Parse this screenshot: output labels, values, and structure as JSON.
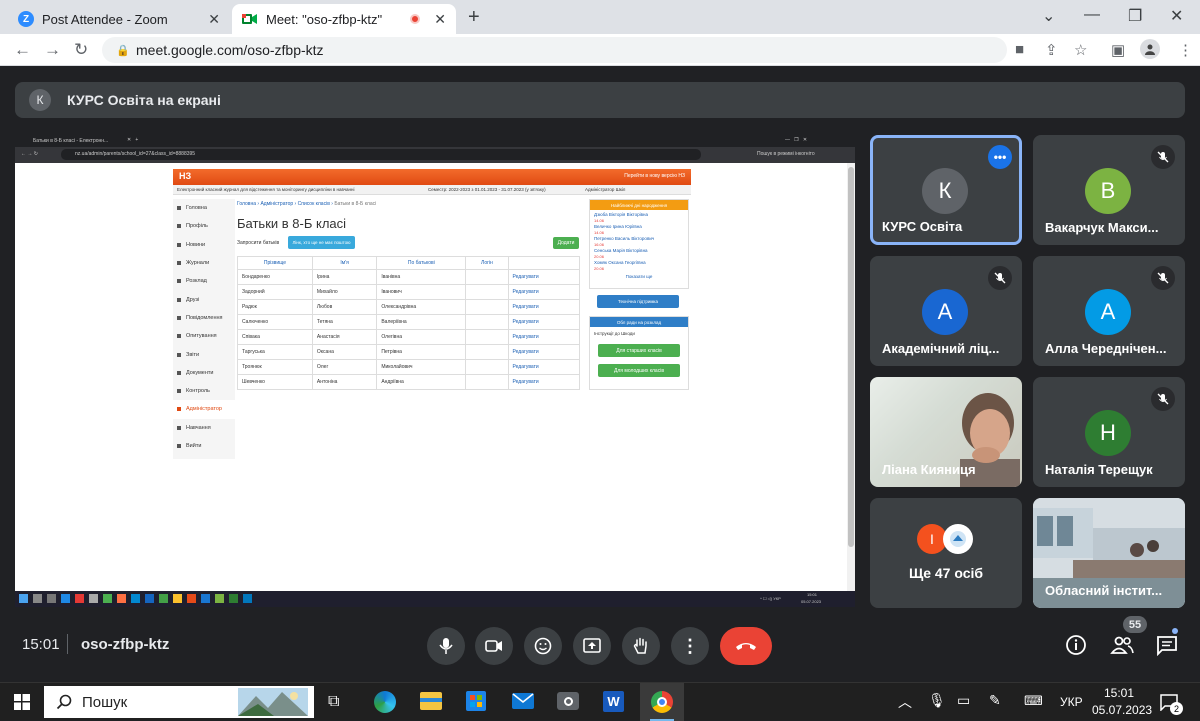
{
  "browser": {
    "tabs": [
      {
        "title": "Post Attendee - Zoom",
        "favicon": "zoom-icon"
      },
      {
        "title": "Meet: \"oso-zfbp-ktz\"",
        "favicon": "meet-icon"
      }
    ],
    "url": "meet.google.com/oso-zfbp-ktz"
  },
  "meet": {
    "banner": {
      "initial": "К",
      "text": "КУРС Освіта на екрані"
    },
    "participants": [
      {
        "name": "КУРС Освіта",
        "initial": "К",
        "color": "#5f6368",
        "active": true
      },
      {
        "name": "Вакарчук Макси...",
        "initial": "В",
        "color": "#7cb342",
        "muted": true
      },
      {
        "name": "Академічний ліц...",
        "initial": "А",
        "color": "#1967d2",
        "muted": true
      },
      {
        "name": "Алла Череднічен...",
        "initial": "А",
        "color": "#039be5",
        "muted": true
      },
      {
        "name": "Ліана Кияниця",
        "video": true
      },
      {
        "name": "Наталія Терещук",
        "initial": "Н",
        "color": "#2e7d32",
        "muted": true
      },
      {
        "name": "Ще 47 осіб",
        "initial": "І",
        "color": "#f4511e"
      },
      {
        "name": "Обласний інстит...",
        "video": true
      }
    ],
    "time": "15:01",
    "meeting_code": "oso-zfbp-ktz",
    "participant_count": "55"
  },
  "shared": {
    "inner_tab": "Батьки в 8-Б класі - Електронн...",
    "inner_url": "nz.ua/admin/parents/school_id=27&class_id=8888395",
    "site_logo": "НЗ",
    "top_link": "Перейти в нову версію НЗ",
    "subheader_text": "Електронний класний журнал для відстеження та моніторингу дисципліни в навчанні",
    "period_label": "Семестр: 2022-2023 з 01.01.2023 - 31.07.2023 (у зв'язку)",
    "user_label": "Адміністратор Шкіл",
    "nav": [
      "Головна",
      "Профіль",
      "Новини",
      "Журнали",
      "Розклад",
      "Друзі",
      "Повідомлення",
      "Опитування",
      "Звіти",
      "Документи",
      "Контроль",
      "Адміністратор",
      "Навчання",
      "Вийти"
    ],
    "breadcrumb": [
      "Головна",
      "Адміністратор",
      "Список класів",
      "Батьки в 8-Б класі"
    ],
    "page_title": "Батьки в 8-Б класі",
    "invite_label": "Запросити батьків",
    "invite_btn": "Лінк, хто ще не має поштою",
    "add_btn": "Додати",
    "table_headers": [
      "Прізвище",
      "Ім'я",
      "По батькові",
      "Логін",
      ""
    ],
    "rows": [
      [
        "Бондаренко",
        "Ірина",
        "Іванівна",
        "",
        "Редагувати"
      ],
      [
        "Задорний",
        "Михайло",
        "Іванович",
        "",
        "Редагувати"
      ],
      [
        "Радюк",
        "Любов",
        "Олександрівна",
        "",
        "Редагувати"
      ],
      [
        "Салюченко",
        "Тетяна",
        "Валеріївна",
        "",
        "Редагувати"
      ],
      [
        "Співака",
        "Анастасія",
        "Олегівна",
        "",
        "Редагувати"
      ],
      [
        "Таргуська",
        "Оксана",
        "Петрівна",
        "",
        "Редагувати"
      ],
      [
        "Троянюк",
        "Олег",
        "Миколайович",
        "",
        "Редагувати"
      ],
      [
        "Шевченко",
        "Антоніна",
        "Андріївна",
        "",
        "Редагувати"
      ]
    ],
    "birthdays_title": "Найближчі дні народження",
    "birthdays": [
      {
        "name": "Дзюба Вікторія Вікторівна",
        "date": "14.06"
      },
      {
        "name": "Величко Ірина Юріївна",
        "date": "14.06"
      },
      {
        "name": "Петренко Василь Вікторович",
        "date": "16.06"
      },
      {
        "name": "Сенська Марія Вікторівна",
        "date": "20.06"
      },
      {
        "name": "Хомяк Оксана Георгіївна",
        "date": "20.06"
      }
    ],
    "show_all": "Показати ще",
    "support_btn": "Технічна підтримка",
    "guide_title": "Обл ради на розклад",
    "guide_text": "Інструкції до Шкоди",
    "guide_btn1": "Для старших класів",
    "guide_btn2": "Для молодших класів",
    "inner_taskbar_time": "15:01",
    "inner_taskbar_date": "05.07.2023"
  },
  "taskbar": {
    "search": "Пошук",
    "lang": "УКР",
    "time": "15:01",
    "date": "05.07.2023",
    "badge": "2"
  },
  "colors": {
    "accent_red": "#ea4335",
    "meet_bg": "#202124",
    "tile_bg": "#3c4043",
    "site_orange": "#f15a24"
  }
}
